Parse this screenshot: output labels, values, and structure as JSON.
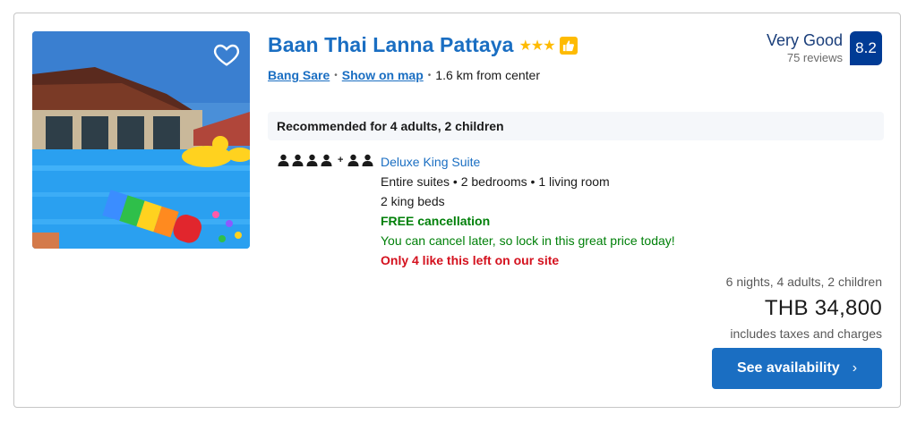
{
  "hotel": {
    "name": "Baan Thai Lanna Pattaya",
    "stars": "★★★",
    "area": "Bang Sare",
    "map_link": "Show on map",
    "distance": "1.6 km from center"
  },
  "rating": {
    "word": "Very Good",
    "reviews": "75 reviews",
    "score": "8.2"
  },
  "recommendation": "Recommended for 4 adults, 2 children",
  "room": {
    "name": "Deluxe King Suite",
    "layout": "Entire suites • 2 bedrooms • 1 living room",
    "beds": "2 king beds",
    "free_cancel": "FREE cancellation",
    "cancel_note": "You can cancel later, so lock in this great price today!",
    "availability_note": "Only 4 like this left on our site",
    "adults_icons": 4,
    "children_icons": 2
  },
  "pricing": {
    "stay": "6 nights, 4 adults, 2 children",
    "price": "THB 34,800",
    "taxes": "includes taxes and charges"
  },
  "cta": {
    "label": "See availability",
    "chevron": "›"
  },
  "icons": {
    "favorite": "heart-icon",
    "thumb": "thumbs-up-icon",
    "person": "person-icon"
  },
  "colors": {
    "link": "#1a6ec2",
    "score_bg": "#003b95",
    "star": "#febb02",
    "green": "#008009",
    "red": "#d4111e"
  }
}
